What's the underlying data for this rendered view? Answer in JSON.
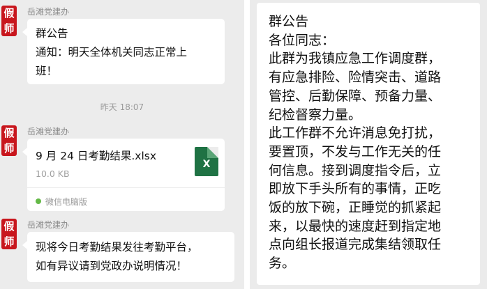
{
  "colors": {
    "avatar_red": "#c8161d",
    "excel_green": "#1f7244",
    "bubble": "#ffffff",
    "background": "#ececec"
  },
  "left_chat": {
    "avatar_text": [
      "假",
      "师"
    ],
    "messages": [
      {
        "sender": "岳滩党建办",
        "lines": [
          "群公告",
          "通知：明天全体机关同志正常上",
          "班！"
        ]
      },
      {
        "sender": "岳滩党建办",
        "file": {
          "name": "9 月 24 日考勤结果.xlsx",
          "size": "10.0 KB",
          "icon": "excel-icon",
          "icon_letter": "X",
          "source": "微信电脑版"
        }
      },
      {
        "sender": "岳滩党建办",
        "lines": [
          "现将今日考勤结果发往考勤平台，",
          "如有异议请到党政办说明情况！"
        ]
      }
    ],
    "timestamp": "昨天 18:07"
  },
  "right_notice": {
    "lines": [
      "群公告",
      "各位同志：",
      "此群为我镇应急工作调度群，",
      "有应急排险、险情突击、道路",
      "管控、后勤保障、预备力量、",
      "纪检督察力量。",
      "此工作群不允许消息免打扰，",
      "要置顶，不发与工作无关的任",
      "何信息。接到调度指令后，立",
      "即放下手头所有的事情，正吃",
      "饭的放下碗，正睡觉的抓紧起",
      "来，以最快的速度赶到指定地",
      "点向组长报道完成集结领取任",
      "务。"
    ]
  }
}
